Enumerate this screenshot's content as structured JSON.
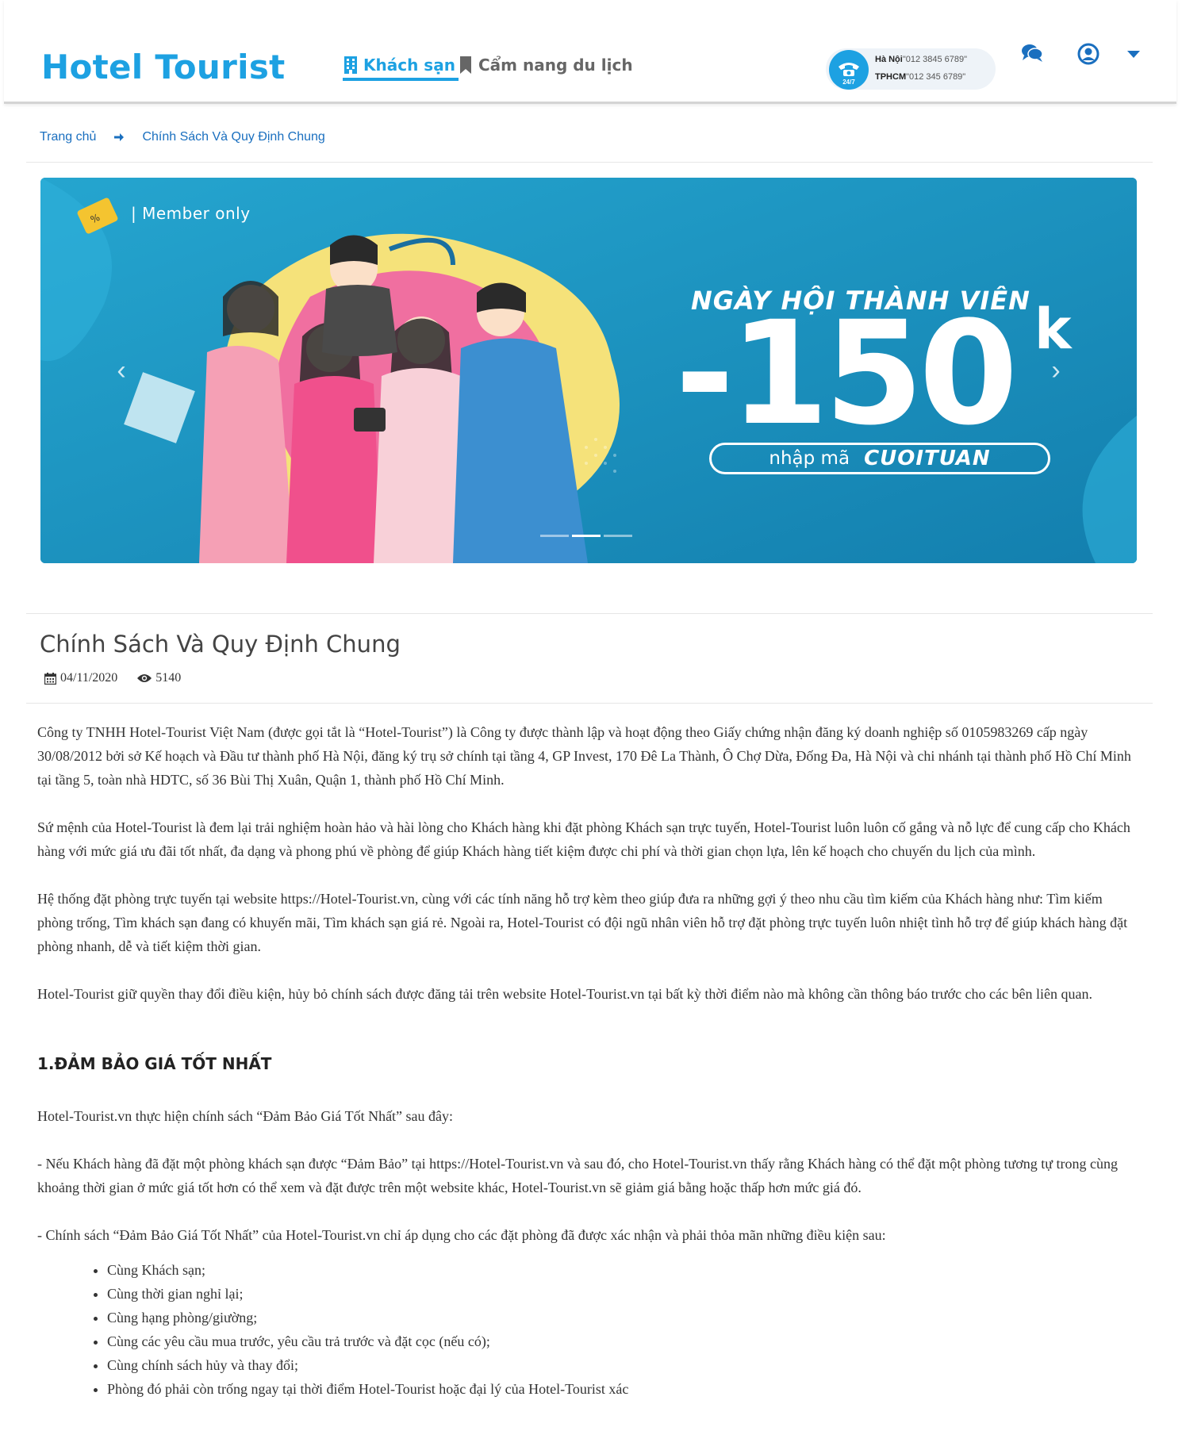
{
  "header": {
    "logo": "Hotel Tourist",
    "nav": [
      {
        "label": "Khách sạn",
        "icon": "building-icon",
        "active": true
      },
      {
        "label": "Cẩm nang du lịch",
        "icon": "bookmark-icon",
        "active": false
      }
    ],
    "hotline": {
      "badge": "24/7",
      "rows": [
        {
          "city": "Hà Nội",
          "phone": "\"012 3845 6789\""
        },
        {
          "city": "TPHCM",
          "phone": "\"012 345 6789\""
        }
      ]
    },
    "icons": [
      "chat-icon",
      "user-icon",
      "caret-down-icon"
    ]
  },
  "breadcrumb": {
    "home": "Trang chủ",
    "current": "Chính Sách Và Quy Định Chung"
  },
  "banner": {
    "tag": "| Member only",
    "title": "NGÀY HỘI THÀNH VIÊN",
    "amount": "-150",
    "unit": "k",
    "code_label": "nhập mã",
    "code": "CUOITUAN",
    "active_slide": 2,
    "slide_count": 3
  },
  "article": {
    "title": "Chính Sách Và Quy Định Chung",
    "date": "04/11/2020",
    "views": "5140",
    "paragraphs": [
      " Công ty TNHH Hotel-Tourist Việt Nam (được gọi tắt là “Hotel-Tourist”) là Công ty được thành lập và hoạt động theo Giấy chứng nhận đăng ký doanh nghiệp số 0105983269 cấp ngày 30/08/2012 bởi sở Kế hoạch và Đầu tư thành phố Hà Nội, đăng ký trụ sở chính tại tầng 4, GP Invest, 170 Đê La Thành, Ô Chợ Dừa, Đống Đa, Hà Nội và chi nhánh tại thành phố Hồ Chí Minh tại tầng 5, toàn nhà HDTC, số 36 Bùi Thị Xuân, Quận 1, thành phố Hồ Chí Minh.",
      "Sứ mệnh của Hotel-Tourist là đem lại trải nghiệm hoàn hảo và hài lòng cho Khách hàng khi đặt phòng Khách sạn trực tuyến, Hotel-Tourist luôn luôn cố gắng và nỗ lực để cung cấp cho Khách hàng với mức giá ưu đãi tốt nhất, đa dạng và phong phú về phòng để giúp Khách hàng tiết kiệm được chi phí và thời gian chọn lựa, lên kế hoạch cho chuyến du lịch của mình.",
      "Hệ thống đặt phòng trực tuyến tại website https://Hotel-Tourist.vn, cùng với các tính năng hỗ trợ kèm theo giúp đưa ra những gợi ý theo nhu cầu tìm kiếm của Khách hàng như: Tìm kiếm phòng trống, Tìm khách sạn đang có khuyến mãi, Tìm khách sạn giá rẻ. Ngoài ra, Hotel-Tourist có đội ngũ nhân viên hỗ trợ đặt phòng trực tuyến luôn nhiệt tình hỗ trợ để giúp khách hàng đặt phòng nhanh, dễ và tiết kiệm thời gian.",
      "Hotel-Tourist giữ quyền thay đổi điều kiện, hủy bỏ chính sách được đăng tải trên website Hotel-Tourist.vn tại bất kỳ thời điểm nào mà không cần thông báo trước cho các bên liên quan."
    ],
    "section1": {
      "heading": "1.ĐẢM BẢO GIÁ TỐT NHẤT",
      "paragraphs": [
        "Hotel-Tourist.vn thực hiện chính sách “Đảm Bảo Giá Tốt Nhất” sau đây:",
        "- Nếu Khách hàng đã đặt một phòng khách sạn được “Đảm Bảo” tại https://Hotel-Tourist.vn và sau đó, cho Hotel-Tourist.vn thấy rằng Khách hàng có thể đặt một phòng tương tự trong cùng khoảng thời gian ở mức giá tốt hơn có thể xem và đặt được trên một website khác, Hotel-Tourist.vn sẽ giảm giá bằng hoặc thấp hơn mức giá đó.",
        "- Chính sách “Đảm Bảo Giá Tốt Nhất” của Hotel-Tourist.vn chỉ áp dụng cho các đặt phòng đã được xác nhận và phải thỏa mãn những điều kiện sau:"
      ],
      "conditions": [
        "Cùng Khách sạn;",
        "Cùng thời gian nghỉ lại;",
        "Cùng hạng phòng/giường;",
        "Cùng các yêu cầu mua trước, yêu cầu trả trước và đặt cọc (nếu có);",
        "Cùng chính sách hủy và thay đổi;",
        "Phòng đó phải còn trống ngay tại thời điểm Hotel-Tourist hoặc đại lý của Hotel-Tourist xác"
      ]
    }
  },
  "colors": {
    "brand": "#1da1e2",
    "link": "#1a6fbf",
    "banner_bg": "#1a8cb8"
  }
}
